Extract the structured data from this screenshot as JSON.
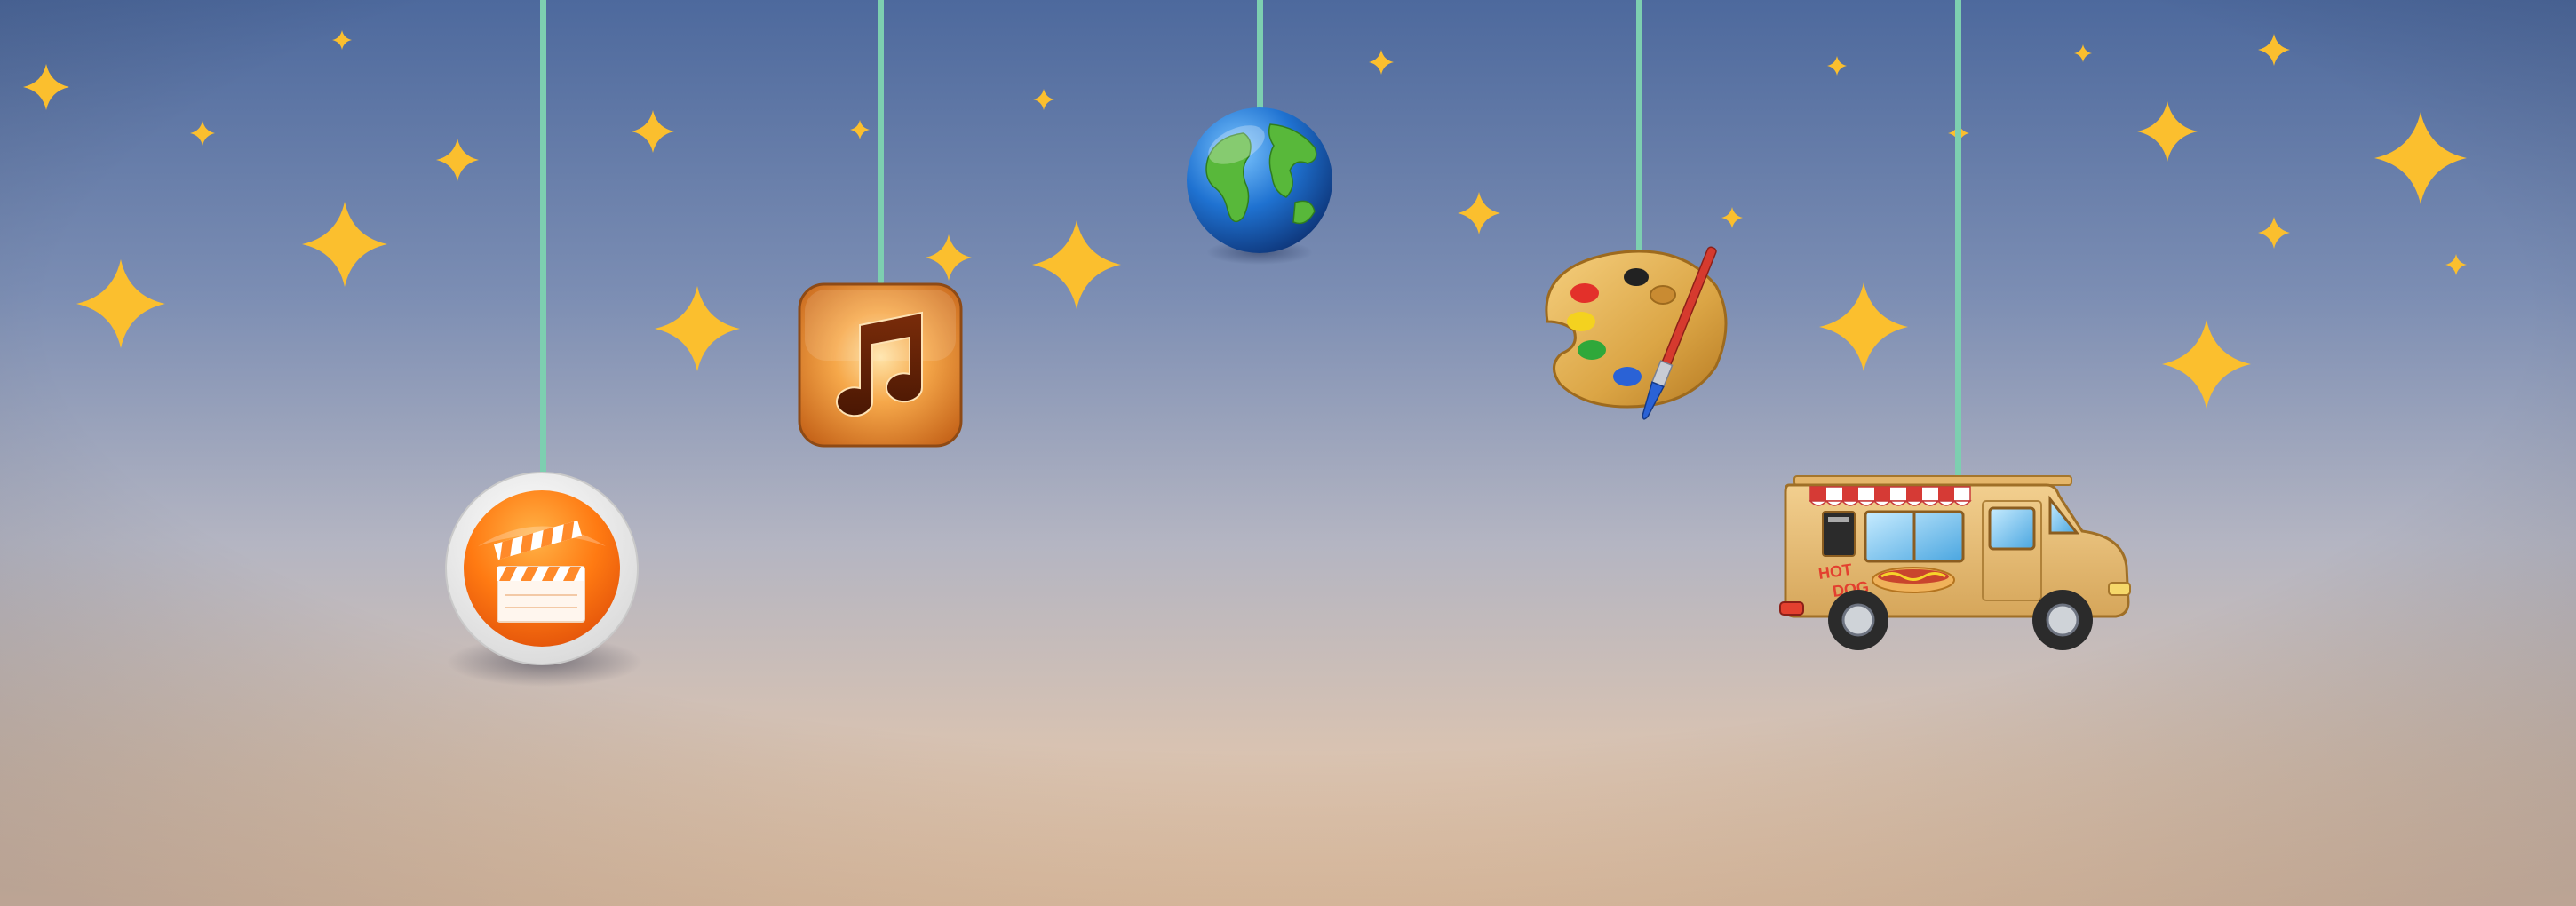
{
  "scene": {
    "description_labels": false,
    "colors": {
      "sky_top": "#4f6b9e",
      "sky_middle": "#a7acbf",
      "sky_bottom": "#f1cfae",
      "star": "#fbbf2e",
      "string": "#7dcfb0"
    }
  },
  "ornaments": [
    {
      "icon": "clapperboard-icon"
    },
    {
      "icon": "music-note-icon"
    },
    {
      "icon": "globe-icon"
    },
    {
      "icon": "paint-palette-icon"
    },
    {
      "icon": "food-truck-icon",
      "truck_text": "HOT DOG"
    }
  ]
}
